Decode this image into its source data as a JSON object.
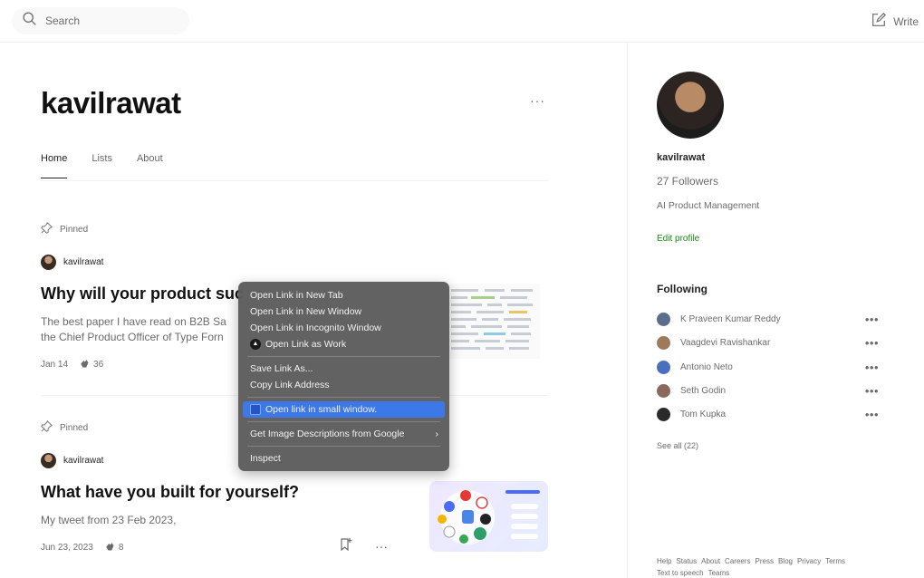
{
  "header": {
    "search_placeholder": "Search",
    "write_label": "Write"
  },
  "profile": {
    "name": "kavilrawat",
    "more_label": "···",
    "tabs": [
      {
        "label": "Home",
        "active": true
      },
      {
        "label": "Lists",
        "active": false
      },
      {
        "label": "About",
        "active": false
      }
    ]
  },
  "posts": [
    {
      "pinned_label": "Pinned",
      "author": "kavilrawat",
      "title": "Why will your product suc",
      "snippet_lines": [
        "The best paper I have read on B2B Sa",
        "the Chief Product Officer of Type Forn"
      ],
      "date": "Jan 14",
      "claps": "36"
    },
    {
      "pinned_label": "Pinned",
      "author": "kavilrawat",
      "title": "What have you built for yourself?",
      "snippet_lines": [
        "My tweet from 23 Feb 2023,"
      ],
      "date": "Jun 23, 2023",
      "claps": "8",
      "more_label": "···"
    }
  ],
  "context_menu": {
    "group1": [
      "Open Link in New Tab",
      "Open Link in New Window",
      "Open Link in Incognito Window",
      "Open Link as Work"
    ],
    "group2": [
      "Save Link As...",
      "Copy Link Address"
    ],
    "highlighted": "Open link in small window.",
    "group3": [
      "Get Image Descriptions from Google"
    ],
    "group4": [
      "Inspect"
    ]
  },
  "sidebar": {
    "name": "kavilrawat",
    "followers": "27 Followers",
    "bio": "AI Product Management",
    "edit_profile": "Edit profile",
    "following_title": "Following",
    "following": [
      {
        "name": "K Praveen Kumar Reddy",
        "color": "#5b6f8a"
      },
      {
        "name": "Vaagdevi Ravishankar",
        "color": "#9c7a5c"
      },
      {
        "name": "Antonio Neto",
        "color": "#4b6fc0"
      },
      {
        "name": "Seth Godin",
        "color": "#8a6a5c"
      },
      {
        "name": "Tom Kupka",
        "color": "#2a2a2a"
      }
    ],
    "row_more": "•••",
    "see_all": "See all (22)",
    "footer_links": [
      "Help",
      "Status",
      "About",
      "Careers",
      "Press",
      "Blog",
      "Privacy",
      "Terms",
      "Text to speech",
      "Teams"
    ]
  },
  "colors": {
    "accent_green": "#1a8917",
    "menu_highlight": "#3c78e8"
  }
}
